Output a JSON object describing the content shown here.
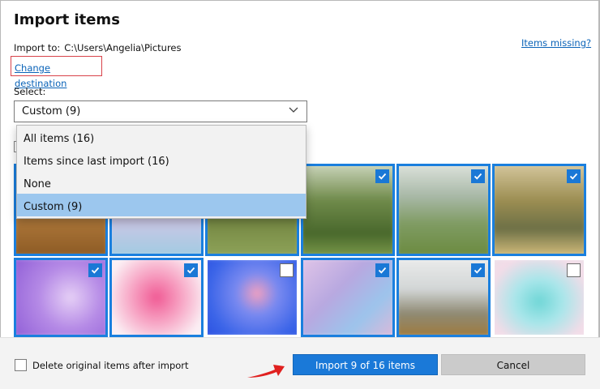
{
  "dialog": {
    "title": "Import items",
    "import_to_label": "Import to:",
    "import_path": "C:\\Users\\Angelia\\Pictures",
    "change_destination": "Change destination",
    "items_missing": "Items missing?"
  },
  "select": {
    "label": "Select:",
    "current": "Custom (9)",
    "options": [
      "All items (16)",
      "Items since last import (16)",
      "None",
      "Custom (9)"
    ],
    "highlighted_index": 3
  },
  "photos": [
    {
      "checked": true
    },
    {
      "checked": true
    },
    {
      "checked": true
    },
    {
      "checked": true
    },
    {
      "checked": true
    },
    {
      "checked": true
    },
    {
      "checked": true
    },
    {
      "checked": true
    },
    {
      "checked": false
    },
    {
      "checked": true
    },
    {
      "checked": true
    },
    {
      "checked": false
    }
  ],
  "footer": {
    "delete_label": "Delete original items after import",
    "delete_checked": false,
    "import_button": "Import 9 of 16 items",
    "cancel_button": "Cancel"
  },
  "colors": {
    "accent": "#1a79d8",
    "link": "#0a63b8",
    "highlight_box": "#d8434a",
    "annotation_arrow": "#e0201f"
  }
}
